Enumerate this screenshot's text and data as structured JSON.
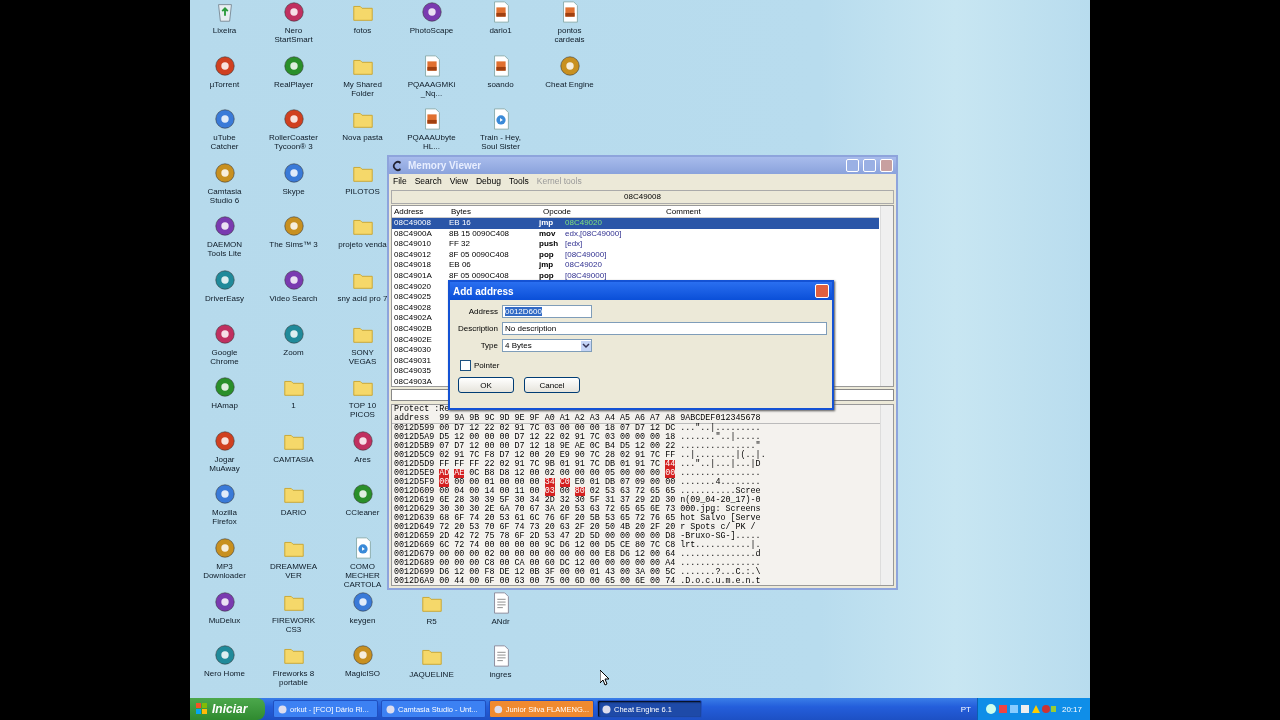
{
  "desktop": {
    "icon_columns": [
      {
        "top": [
          {
            "label": "Lixeira",
            "kind": "bin"
          },
          {
            "label": "µTorrent",
            "kind": "app"
          },
          {
            "label": "uTube Catcher",
            "kind": "app"
          },
          {
            "label": "Camtasia Studio 6",
            "kind": "app"
          },
          {
            "label": "DAEMON Tools Lite",
            "kind": "app"
          },
          {
            "label": "DriverEasy",
            "kind": "app"
          },
          {
            "label": "Google Chrome",
            "kind": "app"
          },
          {
            "label": "HAmap",
            "kind": "app"
          },
          {
            "label": "Jogar MuAway",
            "kind": "app"
          },
          {
            "label": "Mozilla Firefox",
            "kind": "app"
          },
          {
            "label": "MP3 Downloader",
            "kind": "app"
          },
          {
            "label": "MuDelux",
            "kind": "app"
          },
          {
            "label": "Nero Home",
            "kind": "app"
          }
        ]
      },
      {
        "top": [
          {
            "label": "Nero StartSmart",
            "kind": "app"
          },
          {
            "label": "RealPlayer",
            "kind": "app"
          },
          {
            "label": "RollerCoaster Tycoon® 3",
            "kind": "app"
          },
          {
            "label": "Skype",
            "kind": "app"
          },
          {
            "label": "The Sims™ 3",
            "kind": "app"
          },
          {
            "label": "Video Search",
            "kind": "app"
          },
          {
            "label": "Zoom",
            "kind": "app"
          },
          {
            "label": "1",
            "kind": "folder"
          },
          {
            "label": "CAMTASIA",
            "kind": "folder"
          },
          {
            "label": "DARIO",
            "kind": "folder"
          },
          {
            "label": "DREAMWEAVER",
            "kind": "folder"
          },
          {
            "label": "FIREWORK CS3",
            "kind": "folder"
          },
          {
            "label": "Fireworks 8 portable",
            "kind": "folder"
          }
        ]
      },
      {
        "top": [
          {
            "label": "fotos",
            "kind": "folder"
          },
          {
            "label": "My Shared Folder",
            "kind": "folder"
          },
          {
            "label": "Nova pasta",
            "kind": "folder"
          },
          {
            "label": "PILOTOS",
            "kind": "folder"
          },
          {
            "label": "projeto venda",
            "kind": "folder"
          },
          {
            "label": "sny acid pro 7",
            "kind": "folder"
          },
          {
            "label": "SONY VEGAS",
            "kind": "folder"
          },
          {
            "label": "TOP 10 PICOS",
            "kind": "folder"
          },
          {
            "label": "Ares",
            "kind": "app"
          },
          {
            "label": "CCleaner",
            "kind": "app"
          },
          {
            "label": "COMO MECHER CARTOLA",
            "kind": "media"
          },
          {
            "label": "keygen",
            "kind": "app"
          },
          {
            "label": "MagicISO",
            "kind": "app"
          }
        ]
      },
      {
        "top": [
          {
            "label": "PhotoScape",
            "kind": "app"
          },
          {
            "label": "PQAAAGMKi_Nq...",
            "kind": "image"
          },
          {
            "label": "PQAAAUbyteHL...",
            "kind": "image"
          }
        ],
        "bottom": [
          {
            "label": "R5",
            "kind": "folder"
          },
          {
            "label": "JAQUELINE",
            "kind": "folder"
          }
        ]
      },
      {
        "top": [
          {
            "label": "dario1",
            "kind": "image"
          },
          {
            "label": "soando",
            "kind": "image"
          },
          {
            "label": "Train - Hey, Soul Sister",
            "kind": "media"
          }
        ],
        "bottom": [
          {
            "label": "ANdr",
            "kind": "text"
          },
          {
            "label": "ingres",
            "kind": "text"
          }
        ]
      },
      {
        "top": [
          {
            "label": "pontos cardeais",
            "kind": "image"
          },
          {
            "label": "Cheat Engine",
            "kind": "app"
          }
        ]
      }
    ]
  },
  "memory_viewer": {
    "title": "Memory Viewer",
    "menu": [
      {
        "label": "File",
        "disabled": false
      },
      {
        "label": "Search",
        "disabled": false
      },
      {
        "label": "View",
        "disabled": false
      },
      {
        "label": "Debug",
        "disabled": false
      },
      {
        "label": "Tools",
        "disabled": false
      },
      {
        "label": "Kernel tools",
        "disabled": true
      }
    ],
    "address_bar": "08C49008",
    "columns": [
      "Address",
      "Bytes",
      "Opcode",
      "Comment"
    ],
    "rows": [
      {
        "address": "08C49008",
        "bytes": "EB 16",
        "opcode": "jmp",
        "operand": "08C49020",
        "selected": true
      },
      {
        "address": "08C4900A",
        "bytes": "8B 15 0090C408",
        "opcode": "mov",
        "operand": "edx,[08C49000]",
        "selected": false
      },
      {
        "address": "08C49010",
        "bytes": "FF 32",
        "opcode": "push",
        "operand": "[edx]",
        "selected": false
      },
      {
        "address": "08C49012",
        "bytes": "8F 05 0090C408",
        "opcode": "pop",
        "operand": "[08C49000]",
        "selected": false
      },
      {
        "address": "08C49018",
        "bytes": "EB 06",
        "opcode": "jmp",
        "operand": "08C49020",
        "selected": false
      },
      {
        "address": "08C4901A",
        "bytes": "8F 05 0090C408",
        "opcode": "pop",
        "operand": "[08C49000]",
        "selected": false
      },
      {
        "address": "08C49020",
        "selected": false
      },
      {
        "address": "08C49025",
        "selected": false
      },
      {
        "address": "08C49028",
        "selected": false
      },
      {
        "address": "08C4902A",
        "selected": false
      },
      {
        "address": "08C4902B",
        "selected": false
      },
      {
        "address": "08C4902E",
        "selected": false
      },
      {
        "address": "08C49030",
        "selected": false
      },
      {
        "address": "08C49031",
        "selected": false
      },
      {
        "address": "08C49035",
        "selected": false
      },
      {
        "address": "08C4903A",
        "selected": false
      }
    ],
    "hex": {
      "protect": "Protect :Re",
      "header_label": "address",
      "header_columns": [
        "99",
        "9A",
        "9B",
        "9C",
        "9D",
        "9E",
        "9F",
        "A0",
        "A1",
        "A2",
        "A3",
        "A4",
        "A5",
        "A6",
        "A7",
        "A8"
      ],
      "header_ascii": "9ABCDEF012345678",
      "rows": [
        {
          "address": "0012D599",
          "bytes": [
            "00",
            "D7",
            "12",
            "22",
            "02",
            "91",
            "7C",
            "03",
            "00",
            "00",
            "00",
            "18",
            "07",
            "D7",
            "12",
            "DC"
          ],
          "ascii": "...\"..|........."
        },
        {
          "address": "0012D5A9",
          "bytes": [
            "D5",
            "12",
            "00",
            "00",
            "00",
            "D7",
            "12",
            "22",
            "02",
            "91",
            "7C",
            "03",
            "00",
            "00",
            "00",
            "18"
          ],
          "ascii": ".......\"..|....."
        },
        {
          "address": "0012D5B9",
          "bytes": [
            "07",
            "D7",
            "12",
            "00",
            "00",
            "D7",
            "12",
            "18",
            "9E",
            "AE",
            "0C",
            "B4",
            "D5",
            "12",
            "00",
            "22"
          ],
          "ascii": "...............\""
        },
        {
          "address": "0012D5C9",
          "bytes": [
            "02",
            "91",
            "7C",
            "F8",
            "D7",
            "12",
            "00",
            "20",
            "E9",
            "90",
            "7C",
            "28",
            "02",
            "91",
            "7C",
            "FF"
          ],
          "ascii": "..|........|(..|."
        },
        {
          "address": "0012D5D9",
          "bytes": [
            "FF",
            "FF",
            "FF",
            "22",
            "02",
            "91",
            "7C",
            "9B",
            "01",
            "91",
            "7C",
            "DB",
            "01",
            "91",
            "7C",
            "44"
          ],
          "ascii": "...\"..|...|...|D",
          "marked": [
            false,
            false,
            false,
            false,
            false,
            false,
            false,
            false,
            false,
            false,
            false,
            false,
            false,
            false,
            false,
            true
          ]
        },
        {
          "address": "0012D5E9",
          "bytes": [
            "AD",
            "AE",
            "0C",
            "B8",
            "D8",
            "12",
            "00",
            "02",
            "00",
            "00",
            "00",
            "05",
            "00",
            "00",
            "00",
            "00"
          ],
          "ascii": "................",
          "marked": [
            true,
            true,
            false,
            false,
            false,
            false,
            false,
            false,
            false,
            false,
            false,
            false,
            false,
            false,
            false,
            true
          ]
        },
        {
          "address": "0012D5F9",
          "bytes": [
            "00",
            "00",
            "00",
            "01",
            "00",
            "00",
            "00",
            "34",
            "C0",
            "E0",
            "01",
            "DB",
            "07",
            "09",
            "00",
            "00"
          ],
          "ascii": ".......4........",
          "marked": [
            true,
            false,
            false,
            false,
            false,
            false,
            false,
            true,
            true,
            false,
            false,
            false,
            false,
            false,
            false,
            false
          ]
        },
        {
          "address": "0012D609",
          "bytes": [
            "00",
            "04",
            "00",
            "14",
            "00",
            "11",
            "00",
            "03",
            "00",
            "80",
            "02",
            "53",
            "63",
            "72",
            "65",
            "65"
          ],
          "ascii": "...........Scree",
          "marked": [
            false,
            false,
            false,
            false,
            false,
            false,
            false,
            true,
            false,
            true,
            false,
            false,
            false,
            false,
            false,
            false
          ]
        },
        {
          "address": "0012D619",
          "bytes": [
            "6E",
            "28",
            "30",
            "39",
            "5F",
            "30",
            "34",
            "2D",
            "32",
            "30",
            "5F",
            "31",
            "37",
            "29",
            "2D",
            "30"
          ],
          "ascii": "n(09_04-20_17)-0"
        },
        {
          "address": "0012D629",
          "bytes": [
            "30",
            "30",
            "30",
            "2E",
            "6A",
            "70",
            "67",
            "3A",
            "20",
            "53",
            "63",
            "72",
            "65",
            "65",
            "6E",
            "73"
          ],
          "ascii": "000.jpg: Screens"
        },
        {
          "address": "0012D639",
          "bytes": [
            "68",
            "6F",
            "74",
            "20",
            "53",
            "61",
            "6C",
            "76",
            "6F",
            "20",
            "5B",
            "53",
            "65",
            "72",
            "76",
            "65"
          ],
          "ascii": "hot Salvo [Serve"
        },
        {
          "address": "0012D649",
          "bytes": [
            "72",
            "20",
            "53",
            "70",
            "6F",
            "74",
            "73",
            "20",
            "63",
            "2F",
            "20",
            "50",
            "4B",
            "20",
            "2F",
            "20"
          ],
          "ascii": "r Spots c/ PK / "
        },
        {
          "address": "0012D659",
          "bytes": [
            "2D",
            "42",
            "72",
            "75",
            "78",
            "6F",
            "2D",
            "53",
            "47",
            "2D",
            "5D",
            "00",
            "00",
            "00",
            "00",
            "D8"
          ],
          "ascii": "-Bruxo-SG-]....."
        },
        {
          "address": "0012D669",
          "bytes": [
            "6C",
            "72",
            "74",
            "00",
            "00",
            "00",
            "00",
            "9C",
            "D6",
            "12",
            "00",
            "D5",
            "CE",
            "80",
            "7C",
            "C8"
          ],
          "ascii": "lrt...........|."
        },
        {
          "address": "0012D679",
          "bytes": [
            "00",
            "00",
            "00",
            "02",
            "00",
            "00",
            "00",
            "00",
            "00",
            "00",
            "00",
            "E8",
            "D6",
            "12",
            "00",
            "64"
          ],
          "ascii": "...............d"
        },
        {
          "address": "0012D689",
          "bytes": [
            "00",
            "00",
            "00",
            "C8",
            "00",
            "CA",
            "00",
            "60",
            "DC",
            "12",
            "00",
            "00",
            "00",
            "00",
            "00",
            "A4"
          ],
          "ascii": "................"
        },
        {
          "address": "0012D699",
          "bytes": [
            "D6",
            "12",
            "00",
            "F8",
            "DE",
            "12",
            "0B",
            "3F",
            "00",
            "00",
            "01",
            "43",
            "00",
            "3A",
            "00",
            "5C"
          ],
          "ascii": ".......?...C.:.\\"
        },
        {
          "address": "0012D6A9",
          "bytes": [
            "00",
            "44",
            "00",
            "6F",
            "00",
            "63",
            "00",
            "75",
            "00",
            "6D",
            "00",
            "65",
            "00",
            "6E",
            "00",
            "74"
          ],
          "ascii": ".D.o.c.u.m.e.n.t"
        }
      ]
    }
  },
  "dialog": {
    "title": "Add address",
    "address_label": "Address",
    "address_value": "0012D600",
    "text_selected": true,
    "description_label": "Description",
    "description_value": "No description",
    "type_label": "Type",
    "type_value": "4 Bytes",
    "pointer_label": "Pointer",
    "pointer_checked": false,
    "buttons": [
      "OK",
      "Cancel"
    ]
  },
  "taskbar": {
    "start": "Iniciar",
    "tasks": [
      {
        "label": "orkut - [FCO] Dário Ri...",
        "selected": false,
        "flashing": false
      },
      {
        "label": "Camtasia Studio - Unt...",
        "selected": false,
        "flashing": false
      },
      {
        "label": "Junior Silva FLAMENG...",
        "selected": false,
        "flashing": true
      },
      {
        "label": "Cheat Engine 6.1",
        "selected": true,
        "flashing": false
      }
    ],
    "language": "PT",
    "clock": "20:17"
  }
}
